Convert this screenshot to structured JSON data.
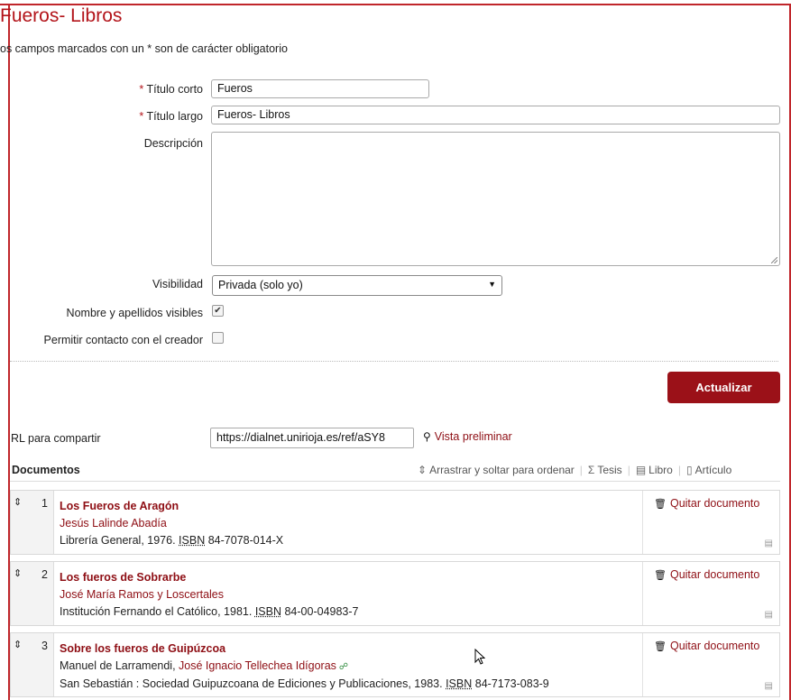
{
  "page": {
    "title": "Fueros- Libros",
    "required_note": "os campos marcados con un * son de carácter obligatorio"
  },
  "form": {
    "short_title": {
      "label": "Título corto",
      "value": "Fueros"
    },
    "long_title": {
      "label": "Título largo",
      "value": "Fueros- Libros"
    },
    "description": {
      "label": "Descripción",
      "value": ""
    },
    "visibility": {
      "label": "Visibilidad",
      "selected": "Privada (solo yo)"
    },
    "names_visible": {
      "label": "Nombre y apellidos visibles",
      "checked": "✔"
    },
    "allow_contact": {
      "label": "Permitir contacto con el creador",
      "checked": ""
    },
    "required_mark": "*",
    "update_label": "Actualizar"
  },
  "share": {
    "label": "RL para compartir",
    "url": "https://dialnet.unirioja.es/ref/aSY8",
    "preview_label": "Vista preliminar"
  },
  "documents": {
    "title": "Documentos",
    "toolbar": {
      "sort_label": "Arrastrar y soltar para ordenar",
      "thesis_label": "Tesis",
      "book_label": "Libro",
      "article_label": "Artículo"
    },
    "remove_label": "Quitar documento",
    "items": [
      {
        "num": "1",
        "title": "Los Fueros de Aragón",
        "author": "Jesús Lalinde Abadía",
        "pub": "Librería General, 1976.",
        "isbn_label": "ISBN",
        "isbn": "84-7078-014-X"
      },
      {
        "num": "2",
        "title": "Los fueros de Sobrarbe",
        "author": "José María Ramos y Loscertales",
        "pub": "Institución Fernando el Católico, 1981.",
        "isbn_label": "ISBN",
        "isbn": "84-00-04983-7"
      },
      {
        "num": "3",
        "title": "Sobre los fueros de Guipúzcoa",
        "author_plain": "Manuel de Larramendi, ",
        "author": "José Ignacio Tellechea Idígoras",
        "pub": "San Sebastián : Sociedad Guipuzcoana de Ediciones y Publicaciones, 1983.",
        "isbn_label": "ISBN",
        "isbn": "84-7173-083-9"
      }
    ]
  },
  "icons": {
    "sort": "sort-arrows-icon",
    "thesis": "sigma-icon",
    "book": "book-icon",
    "article": "document-icon",
    "trash": "trash-icon",
    "search": "magnifier-icon",
    "network": "network-icon"
  },
  "colors": {
    "accent": "#b3141a",
    "button": "#9b1118",
    "frame": "#c0262b"
  }
}
